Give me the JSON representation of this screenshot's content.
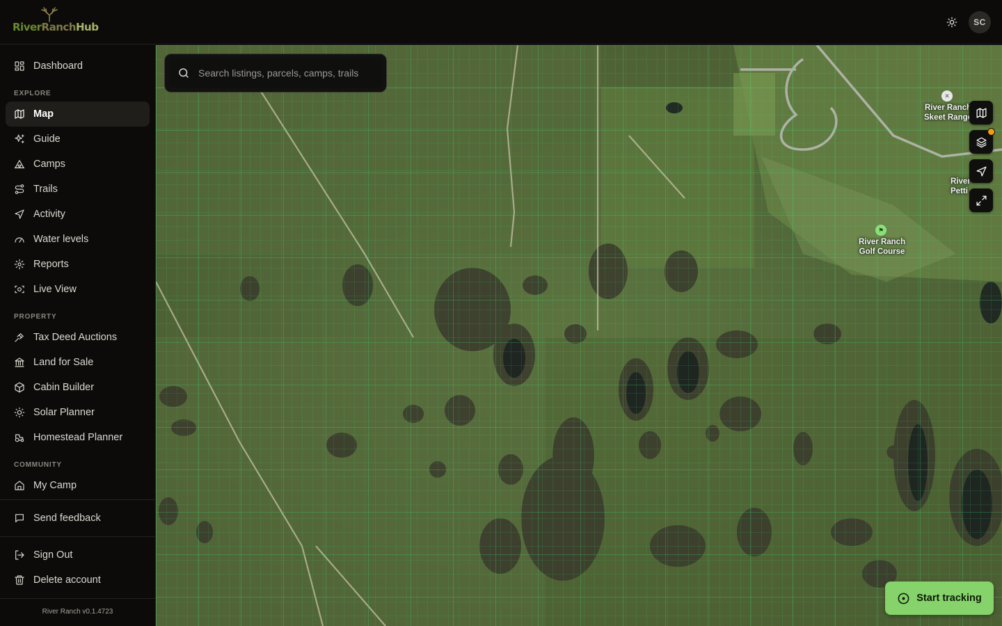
{
  "app": {
    "logo_text_1": "River",
    "logo_text_2": "Ranch",
    "logo_text_3": "Hub",
    "user_initials": "SC"
  },
  "sidebar": {
    "top_item": {
      "label": "Dashboard",
      "icon": "dashboard-icon"
    },
    "sections": {
      "explore": "EXPLORE",
      "property": "PROPERTY",
      "community": "COMMUNITY"
    },
    "explore_items": [
      {
        "label": "Map",
        "icon": "map-icon",
        "active": true
      },
      {
        "label": "Guide",
        "icon": "sparkles-icon"
      },
      {
        "label": "Camps",
        "icon": "tent-icon"
      },
      {
        "label": "Trails",
        "icon": "route-icon"
      },
      {
        "label": "Activity",
        "icon": "navigation-icon"
      },
      {
        "label": "Water levels",
        "icon": "gauge-icon"
      },
      {
        "label": "Reports",
        "icon": "radiate-icon"
      },
      {
        "label": "Live View",
        "icon": "camera-icon"
      }
    ],
    "property_items": [
      {
        "label": "Tax Deed Auctions",
        "icon": "gavel-icon"
      },
      {
        "label": "Land for Sale",
        "icon": "bank-icon"
      },
      {
        "label": "Cabin Builder",
        "icon": "box-icon"
      },
      {
        "label": "Solar Planner",
        "icon": "sun-icon"
      },
      {
        "label": "Homestead Planner",
        "icon": "tractor-icon"
      }
    ],
    "community_items": [
      {
        "label": "My Camp",
        "icon": "home-icon"
      }
    ],
    "feedback": {
      "label": "Send feedback",
      "icon": "message-icon"
    },
    "sign_out": {
      "label": "Sign Out",
      "icon": "logout-icon"
    },
    "delete_account": {
      "label": "Delete account",
      "icon": "trash-icon"
    },
    "version": "River Ranch v0.1.4723"
  },
  "map": {
    "search_placeholder": "Search listings, parcels, camps, trails",
    "controls": [
      "basemap-icon",
      "layers-icon",
      "locate-icon",
      "fullscreen-icon"
    ],
    "labels": {
      "skeet_line1": "River Ranch",
      "skeet_line2": "Skeet Range",
      "golf_line1": "River Ranch",
      "golf_line2": "Golf Course",
      "partial_line1": "River",
      "partial_line2": "Petti"
    },
    "track_button": "Start tracking"
  },
  "colors": {
    "accent_green": "#86d26b",
    "notification_orange": "#f59e0b",
    "background": "#0c0b09"
  }
}
